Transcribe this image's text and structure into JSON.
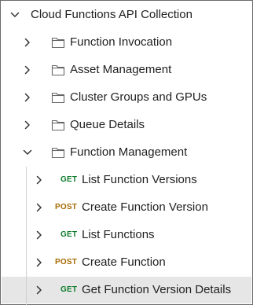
{
  "colors": {
    "get_method": "#0f7b2c",
    "post_method": "#a86a00",
    "selected_row": "#e6e6e6",
    "text": "#212121"
  },
  "collection": {
    "name": "Cloud Functions API Collection",
    "expanded": true,
    "folders": [
      {
        "name": "Function Invocation",
        "expanded": false
      },
      {
        "name": "Asset Management",
        "expanded": false
      },
      {
        "name": "Cluster Groups and GPUs",
        "expanded": false
      },
      {
        "name": "Queue Details",
        "expanded": false
      },
      {
        "name": "Function Management",
        "expanded": true,
        "requests": [
          {
            "method": "GET",
            "name": "List Function Versions",
            "selected": false
          },
          {
            "method": "POST",
            "name": "Create Function Version",
            "selected": false
          },
          {
            "method": "GET",
            "name": "List Functions",
            "selected": false
          },
          {
            "method": "POST",
            "name": "Create Function",
            "selected": false
          },
          {
            "method": "GET",
            "name": "Get Function Version Details",
            "selected": true
          }
        ]
      }
    ]
  }
}
